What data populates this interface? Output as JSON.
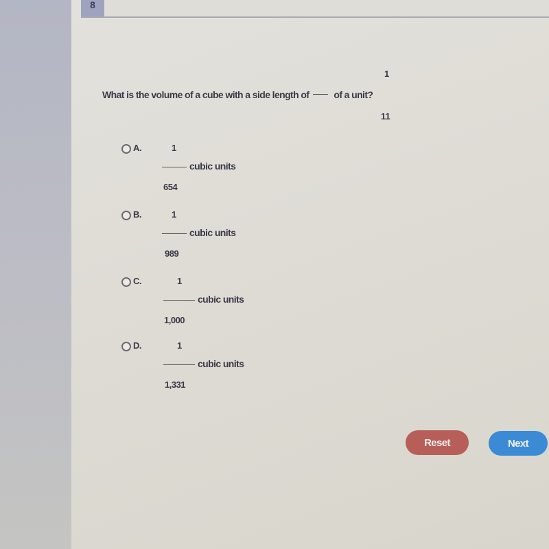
{
  "header": {
    "question_number": "8"
  },
  "question": {
    "text_before": "What is the volume of a cube with a side length of",
    "text_after": "of a unit?",
    "fraction_numerator": "1",
    "fraction_denominator": "11"
  },
  "options": [
    {
      "letter": "A.",
      "numerator": "1",
      "denominator": "654",
      "unit": "cubic units",
      "selected": false
    },
    {
      "letter": "B.",
      "numerator": "1",
      "denominator": "989",
      "unit": "cubic units",
      "selected": false
    },
    {
      "letter": "C.",
      "numerator": "1",
      "denominator": "1,000",
      "unit": "cubic units",
      "selected": false
    },
    {
      "letter": "D.",
      "numerator": "1",
      "denominator": "1,331",
      "unit": "cubic units",
      "selected": false
    }
  ],
  "buttons": {
    "reset_label": "Reset",
    "next_label": "Next",
    "reset_color": "#b85e58",
    "next_color": "#3b8ad6"
  }
}
